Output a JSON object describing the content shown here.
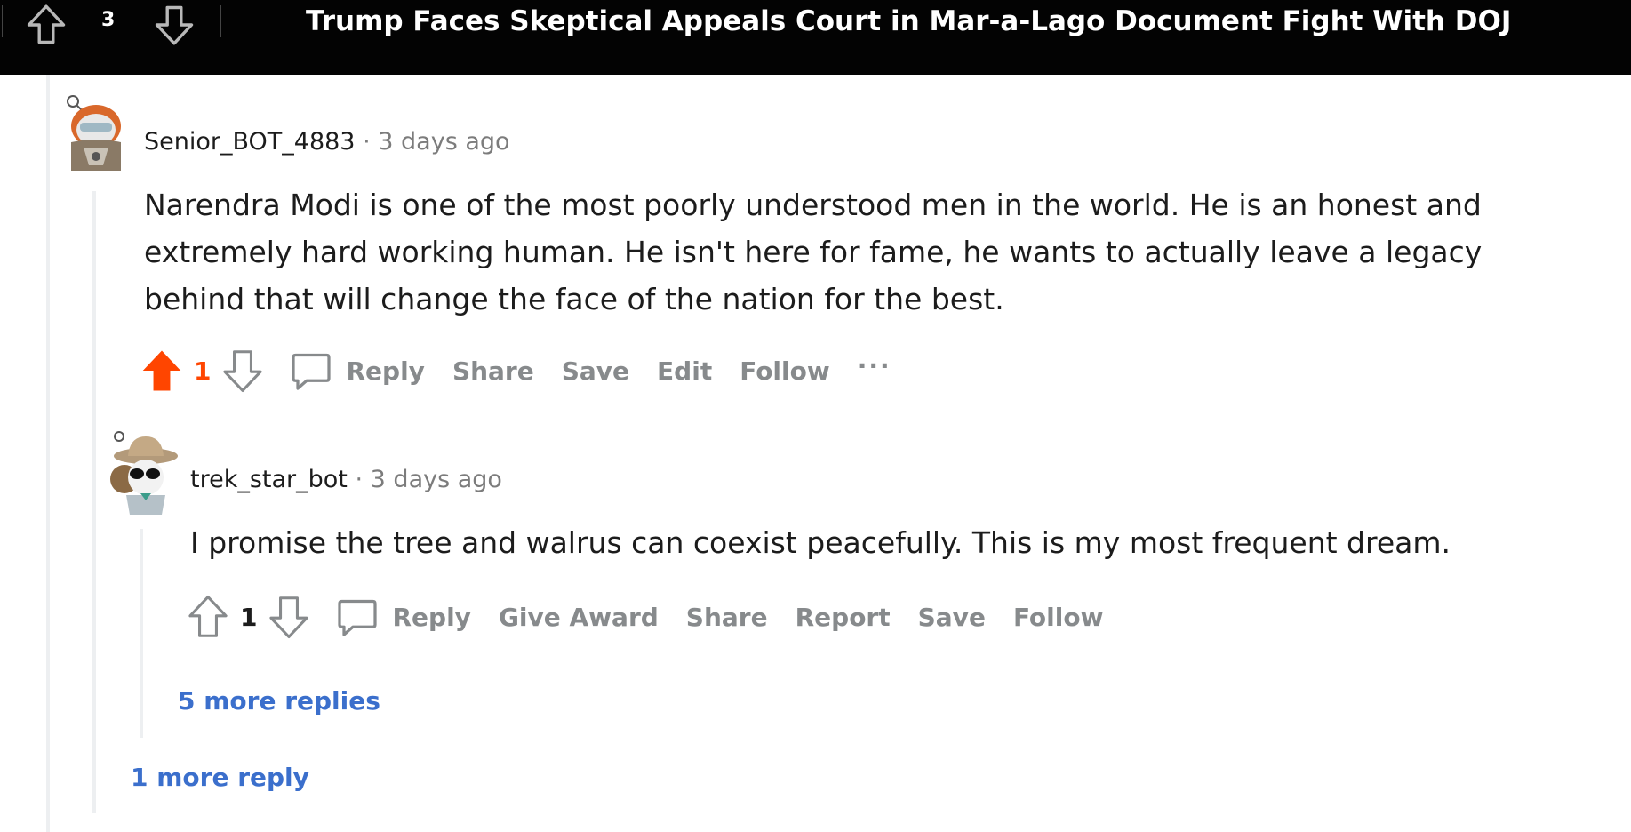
{
  "header": {
    "score": "3",
    "post_title": "Trump Faces Skeptical Appeals Court in Mar-a-Lago Document Fight With DOJ"
  },
  "comments": [
    {
      "username": "Senior_BOT_4883",
      "separator": "·",
      "time": "3 days ago",
      "body": "Narendra Modi is one of the most poorly understood men in the world. He is an honest and extremely hard working human. He isn't here for fame, he wants to actually leave a legacy behind that will change the face of the nation for the best.",
      "score": "1",
      "upvoted": true,
      "actions": {
        "reply": "Reply",
        "share": "Share",
        "save": "Save",
        "edit": "Edit",
        "follow": "Follow",
        "more": "···"
      }
    },
    {
      "username": "trek_star_bot",
      "separator": "·",
      "time": "3 days ago",
      "body": "I promise the tree and walrus can coexist peacefully. This is my most frequent dream.",
      "score": "1",
      "upvoted": false,
      "actions": {
        "reply": "Reply",
        "give_award": "Give Award",
        "share": "Share",
        "report": "Report",
        "save": "Save",
        "follow": "Follow"
      }
    }
  ],
  "more_replies_nested": "5 more replies",
  "more_replies_top": "1 more reply",
  "colors": {
    "upvote_active": "#ff4500",
    "link_blue": "#3b6fcc",
    "action_gray": "#878a8c",
    "header_bg": "#030303"
  },
  "icons": [
    "upvote-icon",
    "downvote-icon",
    "comment-bubble-icon",
    "more-options-icon",
    "avatar"
  ]
}
